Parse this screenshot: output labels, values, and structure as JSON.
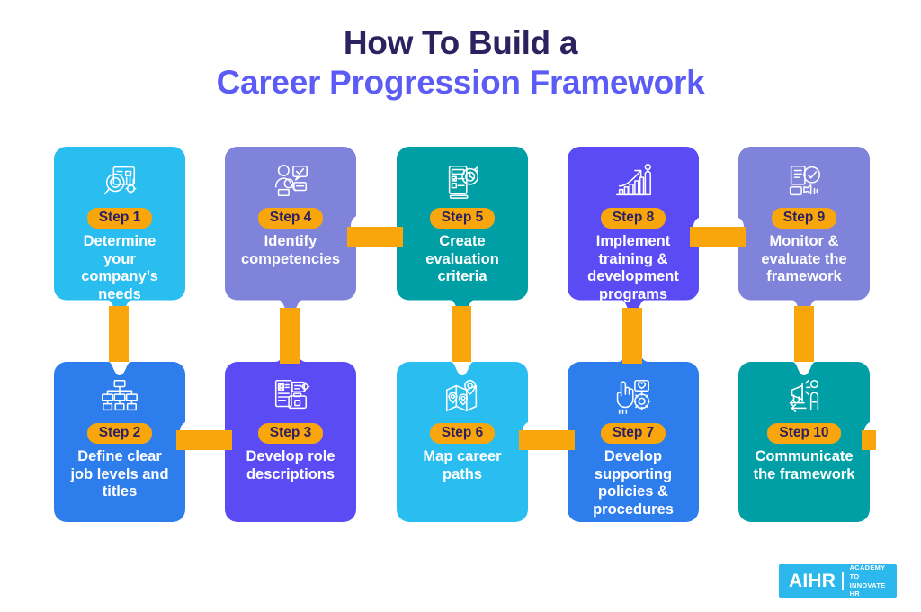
{
  "title": {
    "line1": "How To Build a",
    "line2": "Career Progression Framework",
    "color_line1": "#2D2160",
    "color_line2": "#5B5BF5"
  },
  "palette": {
    "cyan": "#29BDF0",
    "blue": "#2E7DED",
    "periwinkle": "#7F83DA",
    "indigo": "#5B4BF5",
    "teal": "#009FA6",
    "orange": "#F9A60C",
    "badge_text": "#2D2160",
    "background": "#FFFFFF"
  },
  "steps": [
    {
      "badge": "Step 1",
      "label": "Determine\nyour\ncompany’s\nneeds",
      "color": "#29BDF0",
      "icon": "magnifier-report-gear-icon",
      "row": "top",
      "col": 1
    },
    {
      "badge": "Step 2",
      "label": "Define clear\njob levels and\ntitles",
      "color": "#2E7DED",
      "icon": "org-hierarchy-icon",
      "row": "bottom",
      "col": 1
    },
    {
      "badge": "Step 3",
      "label": "Develop role\ndescriptions",
      "color": "#5B4BF5",
      "icon": "role-description-document-icon",
      "row": "bottom",
      "col": 2
    },
    {
      "badge": "Step 4",
      "label": "Identify\ncompetencies",
      "color": "#7F83DA",
      "icon": "person-skills-checklist-icon",
      "row": "top",
      "col": 2
    },
    {
      "badge": "Step 5",
      "label": "Create\nevaluation\ncriteria",
      "color": "#009FA6",
      "icon": "evaluation-criteria-clipboard-icon",
      "row": "top",
      "col": 3
    },
    {
      "badge": "Step 6",
      "label": "Map career\npaths",
      "color": "#29BDF0",
      "icon": "career-path-map-pins-icon",
      "row": "bottom",
      "col": 3
    },
    {
      "badge": "Step 7",
      "label": "Develop\nsupporting\npolicies &\nprocedures",
      "color": "#2E7DED",
      "icon": "policies-hand-gear-icon",
      "row": "bottom",
      "col": 4
    },
    {
      "badge": "Step 8",
      "label": "Implement\ntraining &\ndevelopment\nprograms",
      "color": "#5B4BF5",
      "icon": "growth-chart-arrow-icon",
      "row": "top",
      "col": 4
    },
    {
      "badge": "Step 9",
      "label": "Monitor &\nevaluate the\nframework",
      "color": "#7F83DA",
      "icon": "monitor-evaluate-check-icon",
      "row": "top",
      "col": 5
    },
    {
      "badge": "Step 10",
      "label": "Communicate\nthe framework",
      "color": "#009FA6",
      "icon": "megaphone-announce-icon",
      "row": "bottom",
      "col": 5
    }
  ],
  "logo": {
    "main": "AIHR",
    "sub": "ACADEMY TO\nINNOVATE HR",
    "background": "#2CB8EC"
  }
}
